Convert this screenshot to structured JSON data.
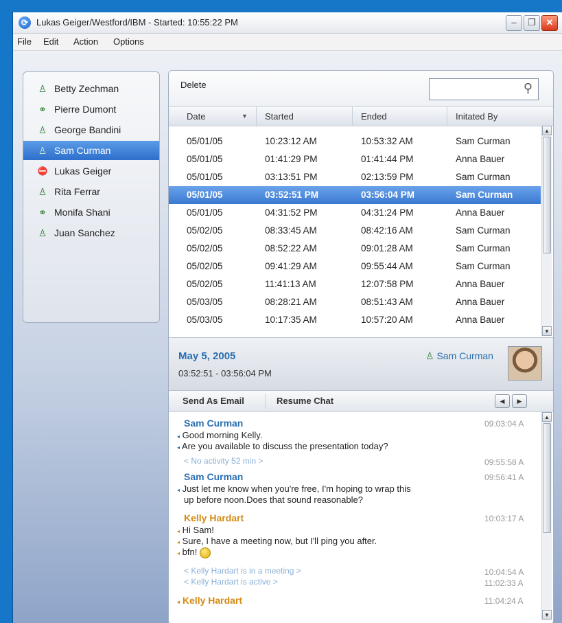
{
  "window": {
    "title": "Lukas Geiger/Westford/IBM - Started: 10:55:22 PM",
    "min_label": "–",
    "max_label": "❐",
    "close_label": "✕"
  },
  "menu": [
    "File",
    "Edit",
    "Action",
    "Options"
  ],
  "contacts": [
    {
      "name": "Betty Zechman",
      "icon": "person-icon",
      "glyph": "♙"
    },
    {
      "name": "Pierre Dumont",
      "icon": "group-icon",
      "glyph": "⚭"
    },
    {
      "name": "George Bandini",
      "icon": "person-icon",
      "glyph": "♙"
    },
    {
      "name": "Sam Curman",
      "icon": "person-icon",
      "glyph": "♙",
      "selected": true
    },
    {
      "name": "Lukas Geiger",
      "icon": "do-not-disturb-icon",
      "glyph": "⛔"
    },
    {
      "name": "Rita Ferrar",
      "icon": "person-icon",
      "glyph": "♙"
    },
    {
      "name": "Monifa Shani",
      "icon": "group-icon",
      "glyph": "⚭"
    },
    {
      "name": "Juan Sanchez",
      "icon": "person-icon",
      "glyph": "♙"
    }
  ],
  "history": {
    "delete_label": "Delete",
    "search_placeholder": "",
    "columns": [
      "Date",
      "Started",
      "Ended",
      "Initated By"
    ],
    "rows": [
      {
        "date": "05/01/05",
        "started": "10:23:12 AM",
        "ended": "10:53:32 AM",
        "by": "Sam Curman"
      },
      {
        "date": "05/01/05",
        "started": "01:41:29 PM",
        "ended": "01:41:44  PM",
        "by": "Anna Bauer"
      },
      {
        "date": "05/01/05",
        "started": "03:13:51 PM",
        "ended": "02:13:59 PM",
        "by": "Sam Curman"
      },
      {
        "date": "05/01/05",
        "started": "03:52:51 PM",
        "ended": "03:56:04 PM",
        "by": "Sam Curman",
        "selected": true
      },
      {
        "date": "05/01/05",
        "started": "04:31:52 PM",
        "ended": "04:31:24 PM",
        "by": "Anna Bauer"
      },
      {
        "date": "05/02/05",
        "started": "08:33:45 AM",
        "ended": "08:42:16 AM",
        "by": "Sam Curman"
      },
      {
        "date": "05/02/05",
        "started": "08:52:22 AM",
        "ended": "09:01:28 AM",
        "by": "Sam Curman"
      },
      {
        "date": "05/02/05",
        "started": "09:41:29 AM",
        "ended": "09:55:44 AM",
        "by": "Sam Curman"
      },
      {
        "date": "05/02/05",
        "started": "11:41:13 AM",
        "ended": "12:07:58 PM",
        "by": "Anna Bauer"
      },
      {
        "date": "05/03/05",
        "started": "08:28:21 AM",
        "ended": "08:51:43 AM",
        "by": "Anna Bauer"
      },
      {
        "date": "05/03/05",
        "started": "10:17:35 AM",
        "ended": "10:57:20 AM",
        "by": "Anna Bauer"
      }
    ]
  },
  "detail": {
    "date": "May 5, 2005",
    "time_range": "03:52:51 - 03:56:04 PM",
    "person": "Sam Curman"
  },
  "chat_toolbar": {
    "send_email": "Send As Email",
    "resume_chat": "Resume Chat",
    "prev": "◀",
    "next": "▶"
  },
  "chat": {
    "m1_sender": "Sam Curman",
    "m1_time": "09:03:04 A",
    "m1_line1": "Good morning Kelly.",
    "m1_line2": "Are you available to discuss the presentation today?",
    "s1_text": "< No activity 52 min >",
    "s1_time": "09:55:58 A",
    "m2_sender": "Sam Curman",
    "m2_time": "09:56:41 A",
    "m2_line1": "Just let me know when you're free, I'm hoping to wrap this",
    "m2_line2": "up before noon.Does that sound reasonable?",
    "m3_sender": "Kelly Hardart",
    "m3_time": "10:03:17 A",
    "m3_line1": "Hi Sam!",
    "m3_line2": "Sure, I have a meeting now, but I'll ping you after.",
    "m3_line3": "bfn!",
    "s2_text": "< Kelly Hardart is in a meeting >",
    "s2_time": "10:04:54 A",
    "s3_text": "< Kelly Hardart  is active >",
    "s3_time": "11:02:33 A",
    "m4_sender": "Kelly Hardart",
    "m4_time": "11:04:24 A"
  },
  "colors": {
    "accent": "#2a6fb0",
    "selection": "#3a78d1",
    "kelly": "#d48a14",
    "background": "#1676c8"
  }
}
